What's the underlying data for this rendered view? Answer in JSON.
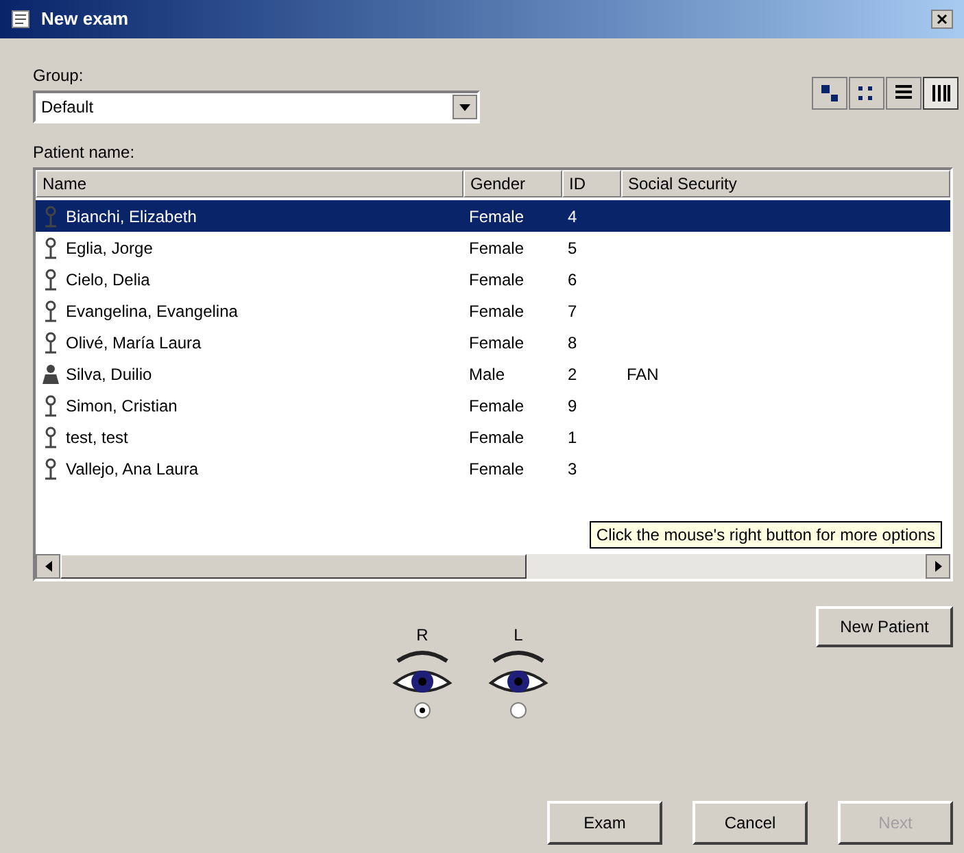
{
  "window": {
    "title": "New exam"
  },
  "group": {
    "label": "Group:",
    "value": "Default"
  },
  "view_buttons": [
    {
      "kind": "large",
      "selected": false
    },
    {
      "kind": "small",
      "selected": false
    },
    {
      "kind": "list",
      "selected": false
    },
    {
      "kind": "details",
      "selected": true
    }
  ],
  "patients": {
    "label": "Patient name:",
    "columns": [
      "Name",
      "Gender",
      "ID",
      "Social Security"
    ],
    "rows": [
      {
        "kind": "female",
        "selected": true,
        "cells": [
          "Bianchi, Elizabeth",
          "Female",
          "4",
          ""
        ]
      },
      {
        "kind": "female",
        "selected": false,
        "cells": [
          "Eglia, Jorge",
          "Female",
          "5",
          ""
        ]
      },
      {
        "kind": "female",
        "selected": false,
        "cells": [
          "Cielo, Delia",
          "Female",
          "6",
          ""
        ]
      },
      {
        "kind": "female",
        "selected": false,
        "cells": [
          "Evangelina, Evangelina",
          "Female",
          "7",
          ""
        ]
      },
      {
        "kind": "female",
        "selected": false,
        "cells": [
          "Olivé, María Laura",
          "Female",
          "8",
          ""
        ]
      },
      {
        "kind": "male",
        "selected": false,
        "cells": [
          "Silva, Duilio",
          "Male",
          "2",
          "FAN"
        ]
      },
      {
        "kind": "female",
        "selected": false,
        "cells": [
          "Simon, Cristian",
          "Female",
          "9",
          ""
        ]
      },
      {
        "kind": "female",
        "selected": false,
        "cells": [
          "test, test",
          "Female",
          "1",
          ""
        ]
      },
      {
        "kind": "female",
        "selected": false,
        "cells": [
          "Vallejo, Ana Laura",
          "Female",
          "3",
          ""
        ]
      }
    ],
    "tooltip": "Click the mouse's right button for more options"
  },
  "new_patient_button": "New Patient",
  "eyes": [
    {
      "label": "R",
      "selected": true
    },
    {
      "label": "L",
      "selected": false
    }
  ],
  "buttons": [
    {
      "label": "Exam",
      "disabled": false
    },
    {
      "label": "Cancel",
      "disabled": false
    },
    {
      "label": "Next",
      "disabled": true
    }
  ]
}
